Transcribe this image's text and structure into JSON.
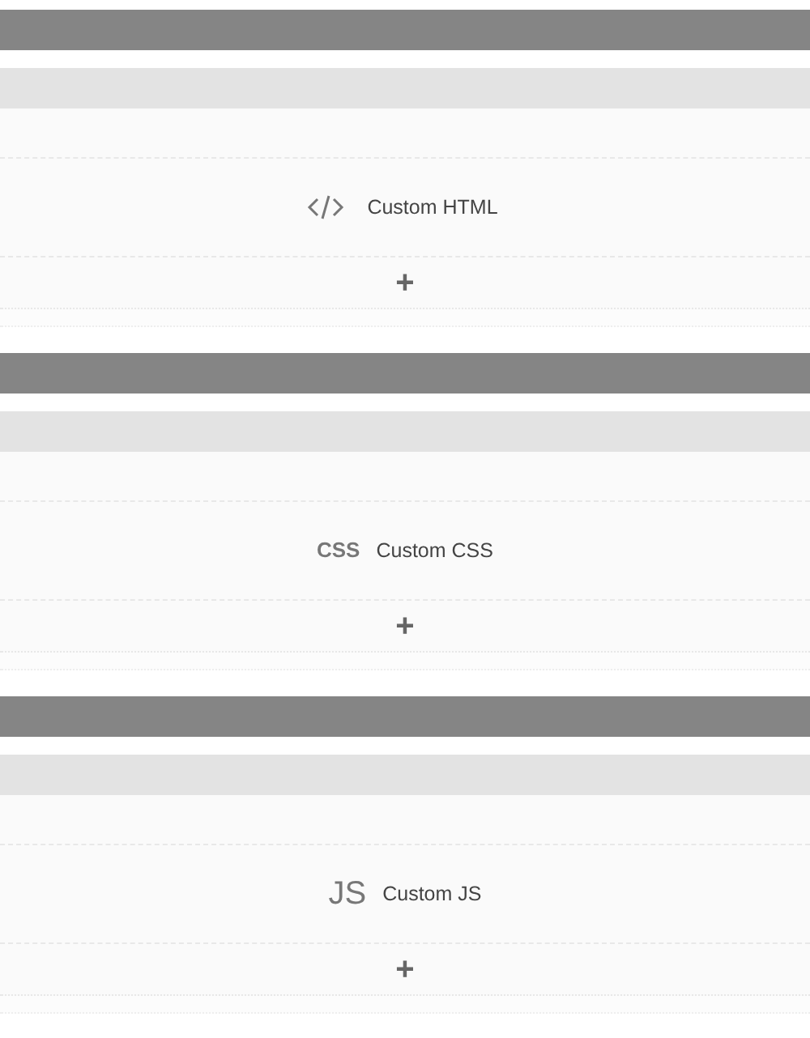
{
  "sections": [
    {
      "kind": "code",
      "label": "Custom HTML",
      "add": "+"
    },
    {
      "kind": "css",
      "icon_text": "CSS",
      "label": "Custom CSS",
      "add": "+"
    },
    {
      "kind": "js",
      "icon_text": "JS",
      "label": "Custom JS",
      "add": "+"
    }
  ]
}
